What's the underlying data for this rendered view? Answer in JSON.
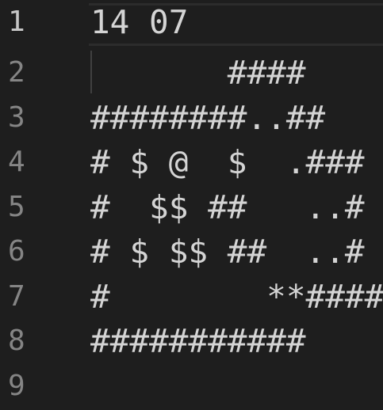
{
  "editor": {
    "lines": [
      {
        "number": "1",
        "text": "14 07"
      },
      {
        "number": "2",
        "text": "       ####"
      },
      {
        "number": "3",
        "text": "########..##"
      },
      {
        "number": "4",
        "text": "# $ @  $  .###"
      },
      {
        "number": "5",
        "text": "#  $$ ##   ..#"
      },
      {
        "number": "6",
        "text": "# $ $$ ##  ..#"
      },
      {
        "number": "7",
        "text": "#        **####"
      },
      {
        "number": "8",
        "text": "###########"
      },
      {
        "number": "9",
        "text": ""
      }
    ],
    "colors": {
      "background": "#1e1e1e",
      "text": "#d4d4d4",
      "line_number": "#858585",
      "active_line_number": "#c6c6c6"
    }
  }
}
